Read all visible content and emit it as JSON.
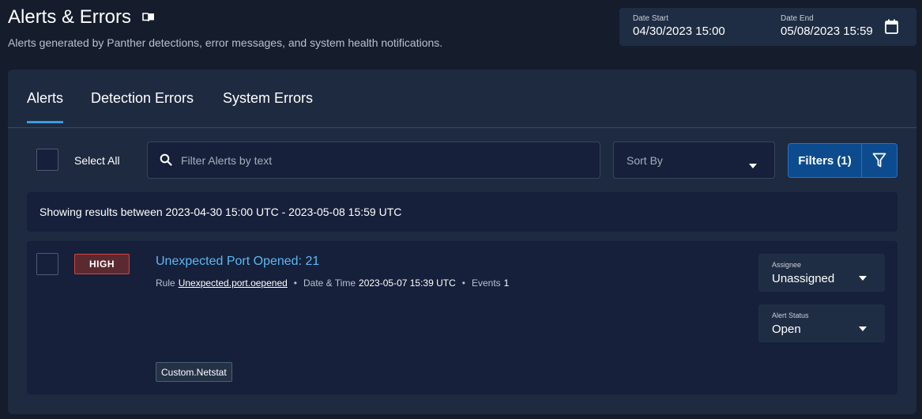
{
  "header": {
    "title": "Alerts & Errors",
    "subtitle": "Alerts generated by Panther detections, error messages, and system health notifications."
  },
  "date_range": {
    "start_label": "Date Start",
    "start_value": "04/30/2023 15:00",
    "end_label": "Date End",
    "end_value": "05/08/2023 15:59"
  },
  "tabs": [
    {
      "label": "Alerts",
      "active": true
    },
    {
      "label": "Detection Errors",
      "active": false
    },
    {
      "label": "System Errors",
      "active": false
    }
  ],
  "toolbar": {
    "select_all_label": "Select All",
    "search_placeholder": "Filter Alerts by text",
    "sort_placeholder": "Sort By",
    "filters_label": "Filters (1)"
  },
  "results": {
    "summary": "Showing results between 2023-04-30 15:00 UTC - 2023-05-08 15:59 UTC"
  },
  "alerts": [
    {
      "severity": "HIGH",
      "title": "Unexpected Port Opened: 21",
      "rule_label": "Rule",
      "rule_name": "Unexpected.port.oepened",
      "datetime_label": "Date & Time",
      "datetime_value": "2023-05-07 15:39 UTC",
      "events_label": "Events",
      "events_value": "1",
      "assignee_label": "Assignee",
      "assignee_value": "Unassigned",
      "status_label": "Alert Status",
      "status_value": "Open",
      "log_type_tag": "Custom.Netstat"
    }
  ],
  "colors": {
    "background": "#151c2c",
    "panel": "#1e2a40",
    "accent": "#3b9ae1",
    "link": "#5db8f2",
    "severity_high_border": "#d0463e",
    "severity_high_bg": "#5b2a30",
    "primary_button": "#0d4b8f"
  },
  "icons": {
    "title_icon": "book-icon",
    "date_icon": "calendar-icon",
    "search_icon": "search-icon",
    "sort_icon": "caret-down-icon",
    "filter_icon": "funnel-icon"
  }
}
